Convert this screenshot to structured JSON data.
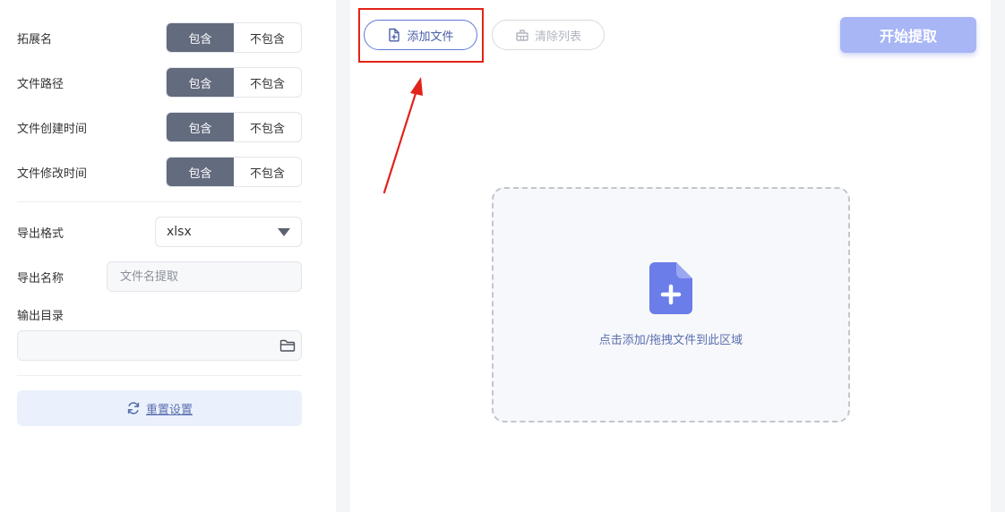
{
  "left": {
    "options": [
      {
        "label": "拓展名",
        "include": "包含",
        "exclude": "不包含",
        "selected": "include"
      },
      {
        "label": "文件路径",
        "include": "包含",
        "exclude": "不包含",
        "selected": "include"
      },
      {
        "label": "文件创建时间",
        "include": "包含",
        "exclude": "不包含",
        "selected": "include"
      },
      {
        "label": "文件修改时间",
        "include": "包含",
        "exclude": "不包含",
        "selected": "include"
      }
    ],
    "export_format": {
      "label": "导出格式",
      "value": "xlsx"
    },
    "export_name": {
      "label": "导出名称",
      "placeholder": "文件名提取"
    },
    "output_dir": {
      "label": "输出目录",
      "value": ""
    },
    "reset_label": "重置设置"
  },
  "right": {
    "add_file_label": "添加文件",
    "clear_list_label": "清除列表",
    "start_label": "开始提取",
    "dropzone_label": "点击添加/拖拽文件到此区域"
  },
  "colors": {
    "toggle_active": "#636b7e",
    "accent": "#5c7ad6",
    "start_button": "#a8b6f6",
    "highlight": "#e2231a"
  }
}
